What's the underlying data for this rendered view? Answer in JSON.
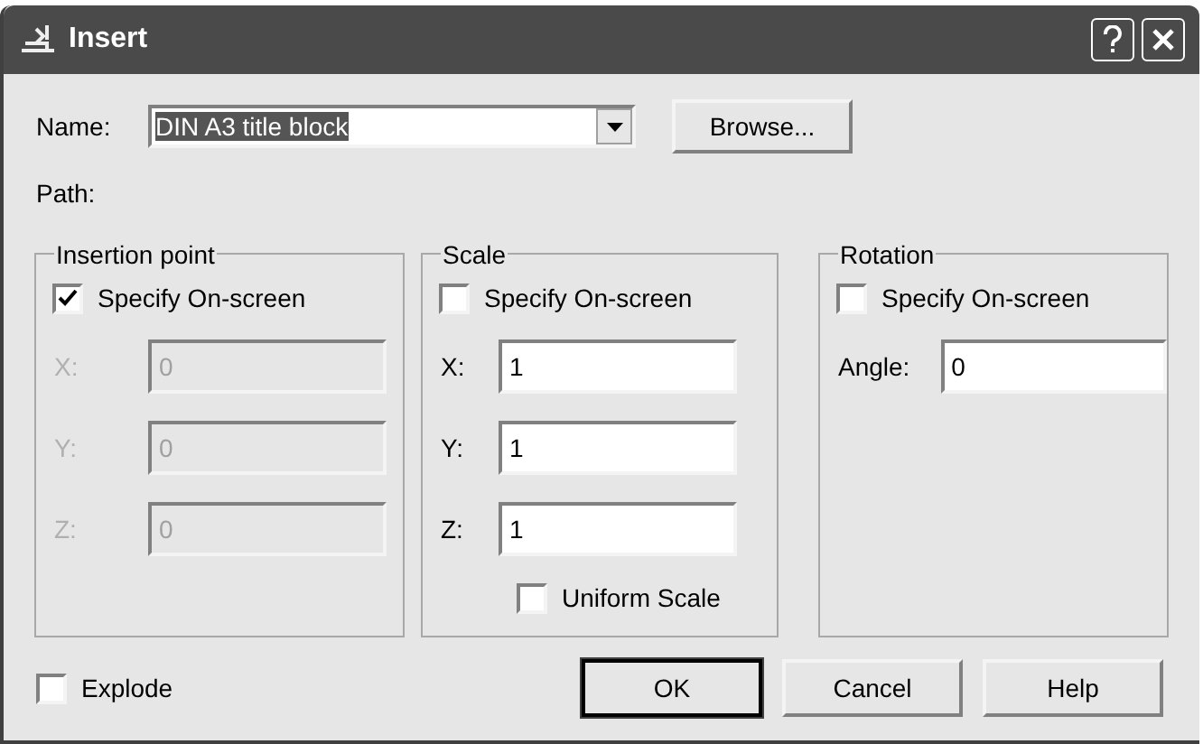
{
  "window": {
    "title": "Insert"
  },
  "name_field": {
    "label": "Name:",
    "value": "DIN A3 title block",
    "text_selected": true
  },
  "browse_button": "Browse...",
  "path": {
    "label": "Path:"
  },
  "groups": [
    {
      "title": "Insertion point",
      "specify": {
        "label": "Specify On-screen",
        "checked": true
      },
      "fields": [
        {
          "label": "X:",
          "value": "0",
          "disabled": true
        },
        {
          "label": "Y:",
          "value": "0",
          "disabled": true
        },
        {
          "label": "Z:",
          "value": "0",
          "disabled": true
        }
      ]
    },
    {
      "title": "Scale",
      "specify": {
        "label": "Specify On-screen",
        "checked": false
      },
      "fields": [
        {
          "label": "X:",
          "value": "1",
          "disabled": false
        },
        {
          "label": "Y:",
          "value": "1",
          "disabled": false
        },
        {
          "label": "Z:",
          "value": "1",
          "disabled": false
        }
      ],
      "extra_checkbox": {
        "label": "Uniform Scale",
        "checked": false
      }
    },
    {
      "title": "Rotation",
      "specify": {
        "label": "Specify On-screen",
        "checked": false
      },
      "fields": [
        {
          "label": "Angle:",
          "value": "0",
          "disabled": false
        }
      ]
    }
  ],
  "explode": {
    "label": "Explode",
    "checked": false
  },
  "buttons": [
    {
      "label": "OK",
      "default": true
    },
    {
      "label": "Cancel",
      "default": false
    },
    {
      "label": "Help",
      "default": false
    }
  ]
}
